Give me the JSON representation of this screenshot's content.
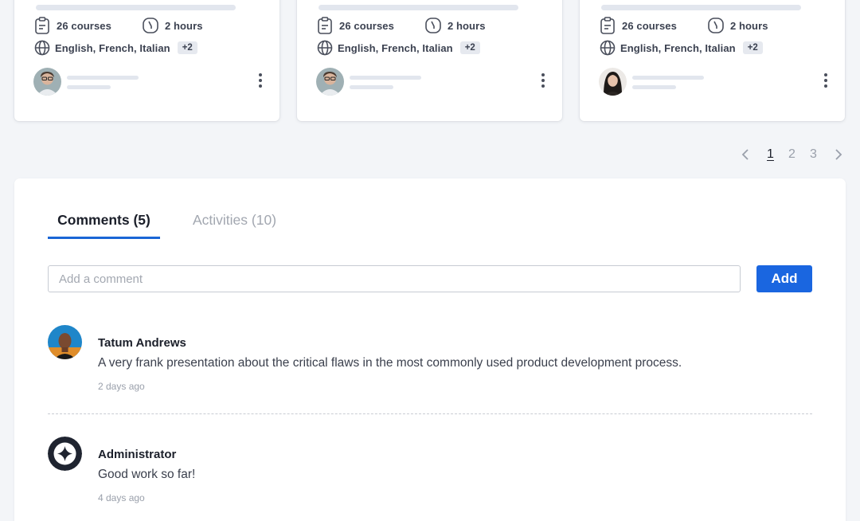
{
  "cards": [
    {
      "courses": "26 courses",
      "duration": "2 hours",
      "languages": "English, French, Italian",
      "extra_langs": "+2",
      "avatar": "man-glasses-avatar"
    },
    {
      "courses": "26 courses",
      "duration": "2 hours",
      "languages": "English, French, Italian",
      "extra_langs": "+2",
      "avatar": "man-glasses-avatar"
    },
    {
      "courses": "26 courses",
      "duration": "2 hours",
      "languages": "English, French, Italian",
      "extra_langs": "+2",
      "avatar": "woman-avatar"
    }
  ],
  "pagination": {
    "pages": [
      "1",
      "2",
      "3"
    ],
    "current": "1"
  },
  "tabs": [
    {
      "label": "Comments (5)",
      "active": true
    },
    {
      "label": "Activities (10)",
      "active": false
    }
  ],
  "comment_box": {
    "placeholder": "Add a comment",
    "button_label": "Add"
  },
  "comments": [
    {
      "author": "Tatum Andrews",
      "text": "A very frank presentation about the critical flaws in the most commonly used product development process.",
      "time": "2 days ago",
      "avatar": "person-avatar"
    },
    {
      "author": "Administrator",
      "text": "Good work so far!",
      "time": "4 days ago",
      "avatar": "admin-logo-avatar"
    }
  ],
  "colors": {
    "accent": "#1a66e0",
    "tab_underline": "#1a66d6",
    "page_bg": "#f3f5f8"
  }
}
